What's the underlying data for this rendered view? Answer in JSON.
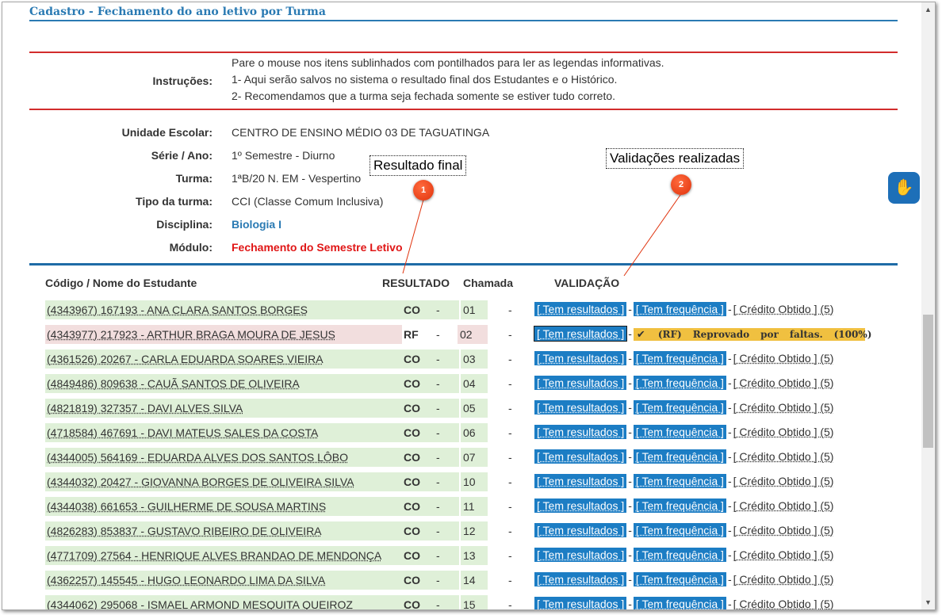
{
  "header": {
    "title": "Cadastro - Fechamento do ano letivo por Turma"
  },
  "instructions": {
    "label": "Instruções:",
    "lines": [
      "Pare o mouse nos itens sublinhados com pontilhados para ler as legendas informativas.",
      "1- Aqui serão salvos no sistema o resultado final dos Estudantes e o Histórico.",
      "2- Recomendamos que a turma seja fechada somente se estiver tudo correto."
    ]
  },
  "info": {
    "unidade_label": "Unidade Escolar:",
    "unidade_value": "CENTRO DE ENSINO MÉDIO 03 DE TAGUATINGA",
    "serie_label": "Série / Ano:",
    "serie_value": "1º Semestre - Diurno",
    "turma_label": "Turma:",
    "turma_value": "1ªB/20 N. EM - Vespertino",
    "tipo_label": "Tipo da turma:",
    "tipo_value": "CCI (Classe Comum Inclusiva)",
    "disciplina_label": "Disciplina:",
    "disciplina_value": "Biologia I",
    "modulo_label": "Módulo:",
    "modulo_value": "Fechamento do Semestre Letivo"
  },
  "callouts": {
    "resultado": {
      "text": "Resultado final",
      "badge": "1"
    },
    "validacoes": {
      "text": "Validações realizadas",
      "badge": "2"
    }
  },
  "accessibility": {
    "icon": "sign-language-hands-icon"
  },
  "table": {
    "headers": {
      "codigo": "Código / Nome do Estudante",
      "resultado": "RESULTADO",
      "chamada": "Chamada",
      "validacao": "VALIDAÇÃO"
    },
    "labels": {
      "tem_resultados": "[ Tem resultados ]",
      "tem_frequencia": "[ Tem frequência ]",
      "credito": "[ Crédito Obtido ] (5)",
      "dash": "-",
      "rf_warning": [
        "(RF)",
        "Reprovado",
        "por",
        "faltas.",
        "(100%)"
      ]
    },
    "rows": [
      {
        "name": "(4343967) 167193 - ANA CLARA SANTOS BORGES",
        "result": "CO",
        "chamada": "01"
      },
      {
        "name": "(4343977) 217923 - ARTHUR BRAGA MOURA DE JESUS",
        "result": "RF",
        "chamada": "02"
      },
      {
        "name": "(4361526) 20267 - CARLA EDUARDA SOARES VIEIRA",
        "result": "CO",
        "chamada": "03"
      },
      {
        "name": "(4849486) 809638 - CAUÃ SANTOS DE OLIVEIRA",
        "result": "CO",
        "chamada": "04"
      },
      {
        "name": "(4821819) 327357 - DAVI ALVES SILVA",
        "result": "CO",
        "chamada": "05"
      },
      {
        "name": "(4718584) 467691 - DAVI MATEUS SALES DA COSTA",
        "result": "CO",
        "chamada": "06"
      },
      {
        "name": "(4344005) 564169 - EDUARDA ALVES DOS SANTOS LÔBO",
        "result": "CO",
        "chamada": "07"
      },
      {
        "name": "(4344032) 20427 - GIOVANNA BORGES DE OLIVEIRA SILVA",
        "result": "CO",
        "chamada": "10"
      },
      {
        "name": "(4344038) 661653 - GUILHERME DE SOUSA MARTINS",
        "result": "CO",
        "chamada": "11"
      },
      {
        "name": "(4826283) 853837 - GUSTAVO RIBEIRO DE OLIVEIRA",
        "result": "CO",
        "chamada": "12"
      },
      {
        "name": "(4771709) 27564 - HENRIQUE ALVES BRANDAO DE MENDONÇA",
        "result": "CO",
        "chamada": "13"
      },
      {
        "name": "(4362257) 145545 - HUGO LEONARDO LIMA DA SILVA",
        "result": "CO",
        "chamada": "14"
      },
      {
        "name": "(4344062) 295068 - ISMAEL ARMOND MESQUITA QUEIROZ",
        "result": "CO",
        "chamada": "15"
      }
    ]
  }
}
